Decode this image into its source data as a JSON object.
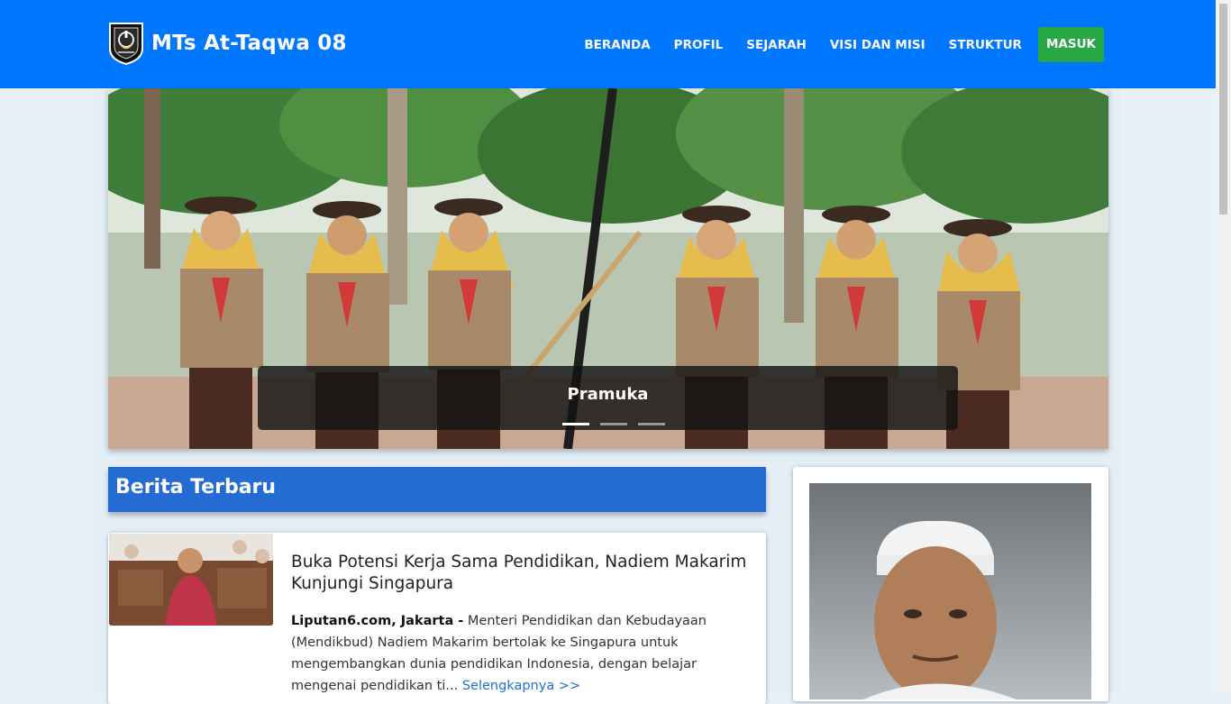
{
  "header": {
    "brand_name": "MTs At-Taqwa 08",
    "nav": [
      "BERANDA",
      "PROFIL",
      "SEJARAH",
      "VISI DAN MISI",
      "STRUKTUR"
    ],
    "login_label": "MASUK"
  },
  "carousel": {
    "caption": "Pramuka",
    "slide_count": 3,
    "active_index": 0
  },
  "news": {
    "section_title": "Berita Terbaru",
    "items": [
      {
        "title": "Buka Potensi Kerja Sama Pendidikan, Nadiem Makarim Kunjungi Singapura",
        "source": "Liputan6.com, Jakarta -",
        "excerpt": "Menteri Pendidikan dan Kebudayaan (Mendikbud) Nadiem Makarim bertolak ke Singapura untuk mengembangkan dunia pendidikan Indonesia, dengan belajar mengenai pendidikan ti...",
        "read_more": "Selengkapnya >>"
      }
    ]
  },
  "colors": {
    "navbar": "#0077ff",
    "login": "#28a745",
    "section_header": "#246bd4",
    "link": "#1f6fd6"
  }
}
